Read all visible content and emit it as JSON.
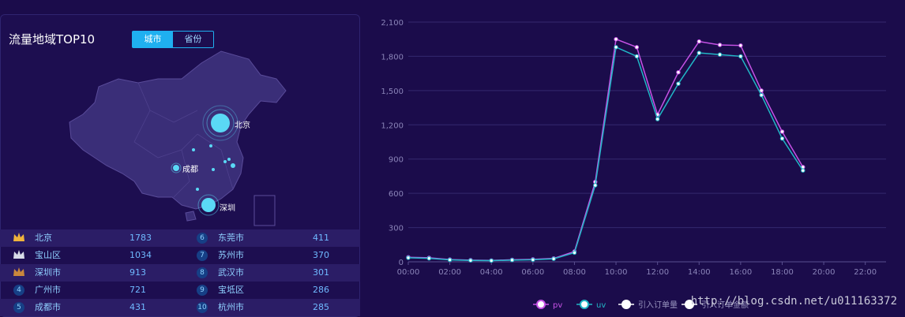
{
  "panel": {
    "title": "流量地域TOP10",
    "toggle": [
      "城市",
      "省份"
    ],
    "active_toggle": "城市"
  },
  "map": {
    "labels": [
      "北京",
      "成都",
      "深圳"
    ]
  },
  "ranking": [
    {
      "rank": 1,
      "name": "北京",
      "value": "1783"
    },
    {
      "rank": 2,
      "name": "宝山区",
      "value": "1034"
    },
    {
      "rank": 3,
      "name": "深圳市",
      "value": "913"
    },
    {
      "rank": 4,
      "name": "广州市",
      "value": "721"
    },
    {
      "rank": 5,
      "name": "成都市",
      "value": "431"
    },
    {
      "rank": 6,
      "name": "东莞市",
      "value": "411"
    },
    {
      "rank": 7,
      "name": "苏州市",
      "value": "370"
    },
    {
      "rank": 8,
      "name": "武汉市",
      "value": "301"
    },
    {
      "rank": 9,
      "name": "宝坻区",
      "value": "286"
    },
    {
      "rank": 10,
      "name": "杭州市",
      "value": "285"
    }
  ],
  "colors": {
    "pv": "#c752e6",
    "uv": "#21b7c6",
    "accent": "#1fb0f0",
    "gold": "#f0b43c",
    "silver": "#d8dce8",
    "bronze": "#c9873c"
  },
  "chart_data": {
    "type": "line",
    "x": [
      "00:00",
      "01:00",
      "02:00",
      "03:00",
      "04:00",
      "05:00",
      "06:00",
      "07:00",
      "08:00",
      "09:00",
      "10:00",
      "11:00",
      "12:00",
      "13:00",
      "14:00",
      "15:00",
      "16:00",
      "17:00",
      "18:00",
      "19:00"
    ],
    "x_ticks": [
      "00:00",
      "02:00",
      "04:00",
      "06:00",
      "08:00",
      "10:00",
      "12:00",
      "14:00",
      "16:00",
      "18:00",
      "20:00",
      "22:00"
    ],
    "y_ticks": [
      "0",
      "300",
      "600",
      "900",
      "1,200",
      "1,500",
      "1,800",
      "2,100"
    ],
    "ylim": [
      0,
      2100
    ],
    "series": [
      {
        "name": "pv",
        "values": [
          40,
          35,
          20,
          15,
          12,
          18,
          22,
          30,
          90,
          700,
          1950,
          1880,
          1290,
          1660,
          1930,
          1900,
          1895,
          1500,
          1140,
          830
        ]
      },
      {
        "name": "uv",
        "values": [
          35,
          30,
          17,
          12,
          10,
          15,
          18,
          26,
          80,
          670,
          1880,
          1800,
          1250,
          1560,
          1830,
          1815,
          1800,
          1460,
          1080,
          800
        ]
      }
    ],
    "legend": [
      "pv",
      "uv",
      "引入订单量",
      "引入订单金额"
    ],
    "grid": true
  },
  "watermark": "http://blog.csdn.net/u011163372"
}
